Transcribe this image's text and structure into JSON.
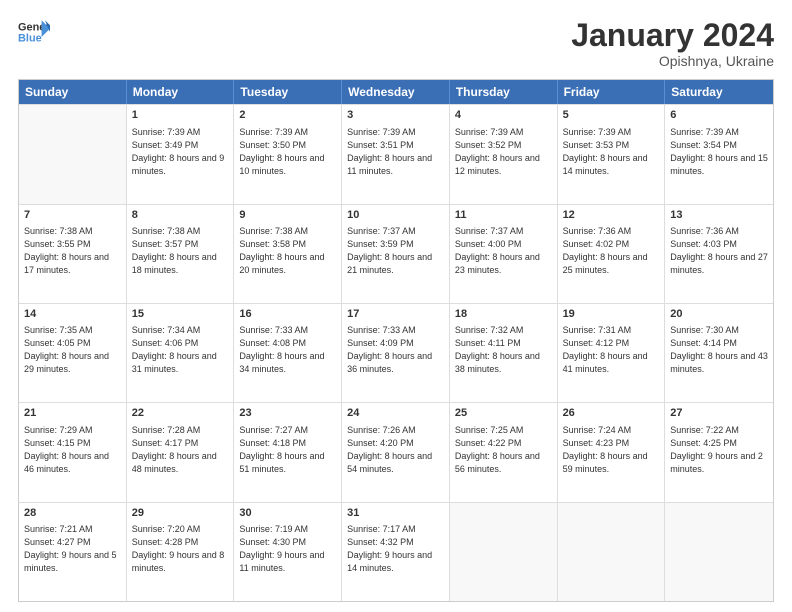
{
  "header": {
    "logo_line1": "General",
    "logo_line2": "Blue",
    "main_title": "January 2024",
    "subtitle": "Opishnya, Ukraine"
  },
  "days_of_week": [
    "Sunday",
    "Monday",
    "Tuesday",
    "Wednesday",
    "Thursday",
    "Friday",
    "Saturday"
  ],
  "weeks": [
    [
      {
        "num": "",
        "sunrise": "",
        "sunset": "",
        "daylight": "",
        "shaded": true,
        "empty": true
      },
      {
        "num": "1",
        "sunrise": "Sunrise: 7:39 AM",
        "sunset": "Sunset: 3:49 PM",
        "daylight": "Daylight: 8 hours and 9 minutes."
      },
      {
        "num": "2",
        "sunrise": "Sunrise: 7:39 AM",
        "sunset": "Sunset: 3:50 PM",
        "daylight": "Daylight: 8 hours and 10 minutes."
      },
      {
        "num": "3",
        "sunrise": "Sunrise: 7:39 AM",
        "sunset": "Sunset: 3:51 PM",
        "daylight": "Daylight: 8 hours and 11 minutes."
      },
      {
        "num": "4",
        "sunrise": "Sunrise: 7:39 AM",
        "sunset": "Sunset: 3:52 PM",
        "daylight": "Daylight: 8 hours and 12 minutes."
      },
      {
        "num": "5",
        "sunrise": "Sunrise: 7:39 AM",
        "sunset": "Sunset: 3:53 PM",
        "daylight": "Daylight: 8 hours and 14 minutes."
      },
      {
        "num": "6",
        "sunrise": "Sunrise: 7:39 AM",
        "sunset": "Sunset: 3:54 PM",
        "daylight": "Daylight: 8 hours and 15 minutes."
      }
    ],
    [
      {
        "num": "7",
        "sunrise": "Sunrise: 7:38 AM",
        "sunset": "Sunset: 3:55 PM",
        "daylight": "Daylight: 8 hours and 17 minutes."
      },
      {
        "num": "8",
        "sunrise": "Sunrise: 7:38 AM",
        "sunset": "Sunset: 3:57 PM",
        "daylight": "Daylight: 8 hours and 18 minutes."
      },
      {
        "num": "9",
        "sunrise": "Sunrise: 7:38 AM",
        "sunset": "Sunset: 3:58 PM",
        "daylight": "Daylight: 8 hours and 20 minutes."
      },
      {
        "num": "10",
        "sunrise": "Sunrise: 7:37 AM",
        "sunset": "Sunset: 3:59 PM",
        "daylight": "Daylight: 8 hours and 21 minutes."
      },
      {
        "num": "11",
        "sunrise": "Sunrise: 7:37 AM",
        "sunset": "Sunset: 4:00 PM",
        "daylight": "Daylight: 8 hours and 23 minutes."
      },
      {
        "num": "12",
        "sunrise": "Sunrise: 7:36 AM",
        "sunset": "Sunset: 4:02 PM",
        "daylight": "Daylight: 8 hours and 25 minutes."
      },
      {
        "num": "13",
        "sunrise": "Sunrise: 7:36 AM",
        "sunset": "Sunset: 4:03 PM",
        "daylight": "Daylight: 8 hours and 27 minutes."
      }
    ],
    [
      {
        "num": "14",
        "sunrise": "Sunrise: 7:35 AM",
        "sunset": "Sunset: 4:05 PM",
        "daylight": "Daylight: 8 hours and 29 minutes."
      },
      {
        "num": "15",
        "sunrise": "Sunrise: 7:34 AM",
        "sunset": "Sunset: 4:06 PM",
        "daylight": "Daylight: 8 hours and 31 minutes."
      },
      {
        "num": "16",
        "sunrise": "Sunrise: 7:33 AM",
        "sunset": "Sunset: 4:08 PM",
        "daylight": "Daylight: 8 hours and 34 minutes."
      },
      {
        "num": "17",
        "sunrise": "Sunrise: 7:33 AM",
        "sunset": "Sunset: 4:09 PM",
        "daylight": "Daylight: 8 hours and 36 minutes."
      },
      {
        "num": "18",
        "sunrise": "Sunrise: 7:32 AM",
        "sunset": "Sunset: 4:11 PM",
        "daylight": "Daylight: 8 hours and 38 minutes."
      },
      {
        "num": "19",
        "sunrise": "Sunrise: 7:31 AM",
        "sunset": "Sunset: 4:12 PM",
        "daylight": "Daylight: 8 hours and 41 minutes."
      },
      {
        "num": "20",
        "sunrise": "Sunrise: 7:30 AM",
        "sunset": "Sunset: 4:14 PM",
        "daylight": "Daylight: 8 hours and 43 minutes."
      }
    ],
    [
      {
        "num": "21",
        "sunrise": "Sunrise: 7:29 AM",
        "sunset": "Sunset: 4:15 PM",
        "daylight": "Daylight: 8 hours and 46 minutes."
      },
      {
        "num": "22",
        "sunrise": "Sunrise: 7:28 AM",
        "sunset": "Sunset: 4:17 PM",
        "daylight": "Daylight: 8 hours and 48 minutes."
      },
      {
        "num": "23",
        "sunrise": "Sunrise: 7:27 AM",
        "sunset": "Sunset: 4:18 PM",
        "daylight": "Daylight: 8 hours and 51 minutes."
      },
      {
        "num": "24",
        "sunrise": "Sunrise: 7:26 AM",
        "sunset": "Sunset: 4:20 PM",
        "daylight": "Daylight: 8 hours and 54 minutes."
      },
      {
        "num": "25",
        "sunrise": "Sunrise: 7:25 AM",
        "sunset": "Sunset: 4:22 PM",
        "daylight": "Daylight: 8 hours and 56 minutes."
      },
      {
        "num": "26",
        "sunrise": "Sunrise: 7:24 AM",
        "sunset": "Sunset: 4:23 PM",
        "daylight": "Daylight: 8 hours and 59 minutes."
      },
      {
        "num": "27",
        "sunrise": "Sunrise: 7:22 AM",
        "sunset": "Sunset: 4:25 PM",
        "daylight": "Daylight: 9 hours and 2 minutes."
      }
    ],
    [
      {
        "num": "28",
        "sunrise": "Sunrise: 7:21 AM",
        "sunset": "Sunset: 4:27 PM",
        "daylight": "Daylight: 9 hours and 5 minutes."
      },
      {
        "num": "29",
        "sunrise": "Sunrise: 7:20 AM",
        "sunset": "Sunset: 4:28 PM",
        "daylight": "Daylight: 9 hours and 8 minutes."
      },
      {
        "num": "30",
        "sunrise": "Sunrise: 7:19 AM",
        "sunset": "Sunset: 4:30 PM",
        "daylight": "Daylight: 9 hours and 11 minutes."
      },
      {
        "num": "31",
        "sunrise": "Sunrise: 7:17 AM",
        "sunset": "Sunset: 4:32 PM",
        "daylight": "Daylight: 9 hours and 14 minutes."
      },
      {
        "num": "",
        "sunrise": "",
        "sunset": "",
        "daylight": "",
        "empty": true
      },
      {
        "num": "",
        "sunrise": "",
        "sunset": "",
        "daylight": "",
        "empty": true
      },
      {
        "num": "",
        "sunrise": "",
        "sunset": "",
        "daylight": "",
        "empty": true
      }
    ]
  ]
}
